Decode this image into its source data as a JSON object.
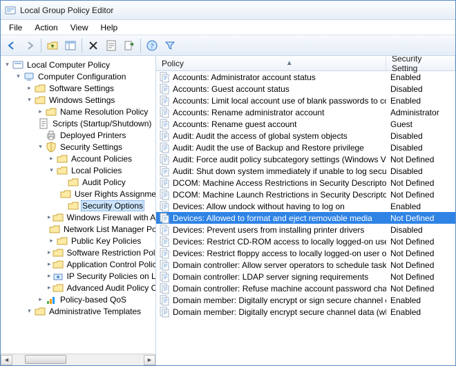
{
  "window": {
    "title": "Local Group Policy Editor"
  },
  "menu": {
    "items": [
      "File",
      "Action",
      "View",
      "Help"
    ]
  },
  "toolbar": {
    "buttons": [
      {
        "name": "back-icon",
        "glyph": "←",
        "color": "#2a72c9"
      },
      {
        "name": "forward-icon",
        "glyph": "→",
        "color": "#9aa7b5"
      },
      {
        "name": "sep"
      },
      {
        "name": "up-icon",
        "glyph": "folder-up"
      },
      {
        "name": "show-hide-tree-icon",
        "glyph": "panes"
      },
      {
        "name": "sep"
      },
      {
        "name": "delete-icon",
        "glyph": "✕",
        "color": "#444"
      },
      {
        "name": "properties-icon",
        "glyph": "props"
      },
      {
        "name": "export-icon",
        "glyph": "export"
      },
      {
        "name": "sep"
      },
      {
        "name": "help-icon",
        "glyph": "?",
        "color": "#2a72c9"
      },
      {
        "name": "filter-icon",
        "glyph": "filter"
      }
    ]
  },
  "tree": {
    "root": "Local Computer Policy",
    "nodes": [
      {
        "depth": 0,
        "exp": "open",
        "icon": "console",
        "label": "Local Computer Policy"
      },
      {
        "depth": 1,
        "exp": "open",
        "icon": "computer",
        "label": "Computer Configuration"
      },
      {
        "depth": 2,
        "exp": "closed",
        "icon": "folder",
        "label": "Software Settings"
      },
      {
        "depth": 2,
        "exp": "open",
        "icon": "folder",
        "label": "Windows Settings"
      },
      {
        "depth": 3,
        "exp": "closed",
        "icon": "folder",
        "label": "Name Resolution Policy"
      },
      {
        "depth": 3,
        "exp": "none",
        "icon": "script",
        "label": "Scripts (Startup/Shutdown)"
      },
      {
        "depth": 3,
        "exp": "none",
        "icon": "printer",
        "label": "Deployed Printers"
      },
      {
        "depth": 3,
        "exp": "open",
        "icon": "shield",
        "label": "Security Settings"
      },
      {
        "depth": 4,
        "exp": "closed",
        "icon": "folder",
        "label": "Account Policies"
      },
      {
        "depth": 4,
        "exp": "open",
        "icon": "folder",
        "label": "Local Policies"
      },
      {
        "depth": 5,
        "exp": "none",
        "icon": "folder",
        "label": "Audit Policy"
      },
      {
        "depth": 5,
        "exp": "none",
        "icon": "folder",
        "label": "User Rights Assignment"
      },
      {
        "depth": 5,
        "exp": "none",
        "icon": "folder",
        "label": "Security Options",
        "selected": true
      },
      {
        "depth": 4,
        "exp": "closed",
        "icon": "folder",
        "label": "Windows Firewall with Advanced Security"
      },
      {
        "depth": 4,
        "exp": "none",
        "icon": "folder",
        "label": "Network List Manager Policies"
      },
      {
        "depth": 4,
        "exp": "closed",
        "icon": "folder",
        "label": "Public Key Policies"
      },
      {
        "depth": 4,
        "exp": "closed",
        "icon": "folder",
        "label": "Software Restriction Policies"
      },
      {
        "depth": 4,
        "exp": "closed",
        "icon": "folder",
        "label": "Application Control Policies"
      },
      {
        "depth": 4,
        "exp": "closed",
        "icon": "ipsec",
        "label": "IP Security Policies on Local Computer"
      },
      {
        "depth": 4,
        "exp": "closed",
        "icon": "folder",
        "label": "Advanced Audit Policy Configuration"
      },
      {
        "depth": 3,
        "exp": "closed",
        "icon": "qos",
        "label": "Policy-based QoS"
      },
      {
        "depth": 2,
        "exp": "open",
        "icon": "folder",
        "label": "Administrative Templates"
      }
    ]
  },
  "list": {
    "columns": {
      "policy": "Policy",
      "setting": "Security Setting"
    },
    "rows": [
      {
        "label": "Accounts: Administrator account status",
        "setting": "Enabled"
      },
      {
        "label": "Accounts: Guest account status",
        "setting": "Disabled"
      },
      {
        "label": "Accounts: Limit local account use of blank passwords to co...",
        "setting": "Enabled"
      },
      {
        "label": "Accounts: Rename administrator account",
        "setting": "Administrator"
      },
      {
        "label": "Accounts: Rename guest account",
        "setting": "Guest"
      },
      {
        "label": "Audit: Audit the access of global system objects",
        "setting": "Disabled"
      },
      {
        "label": "Audit: Audit the use of Backup and Restore privilege",
        "setting": "Disabled"
      },
      {
        "label": "Audit: Force audit policy subcategory settings (Windows Vis...",
        "setting": "Not Defined"
      },
      {
        "label": "Audit: Shut down system immediately if unable to log secur...",
        "setting": "Disabled"
      },
      {
        "label": "DCOM: Machine Access Restrictions in Security Descriptor D...",
        "setting": "Not Defined"
      },
      {
        "label": "DCOM: Machine Launch Restrictions in Security Descriptor ...",
        "setting": "Not Defined"
      },
      {
        "label": "Devices: Allow undock without having to log on",
        "setting": "Enabled"
      },
      {
        "label": "Devices: Allowed to format and eject removable media",
        "setting": "Not Defined",
        "selected": true
      },
      {
        "label": "Devices: Prevent users from installing printer drivers",
        "setting": "Disabled"
      },
      {
        "label": "Devices: Restrict CD-ROM access to locally logged-on user ...",
        "setting": "Not Defined"
      },
      {
        "label": "Devices: Restrict floppy access to locally logged-on user only",
        "setting": "Not Defined"
      },
      {
        "label": "Domain controller: Allow server operators to schedule tasks",
        "setting": "Not Defined"
      },
      {
        "label": "Domain controller: LDAP server signing requirements",
        "setting": "Not Defined"
      },
      {
        "label": "Domain controller: Refuse machine account password chan...",
        "setting": "Not Defined"
      },
      {
        "label": "Domain member: Digitally encrypt or sign secure channel d...",
        "setting": "Enabled"
      },
      {
        "label": "Domain member: Digitally encrypt secure channel data (wh...",
        "setting": "Enabled"
      }
    ]
  }
}
